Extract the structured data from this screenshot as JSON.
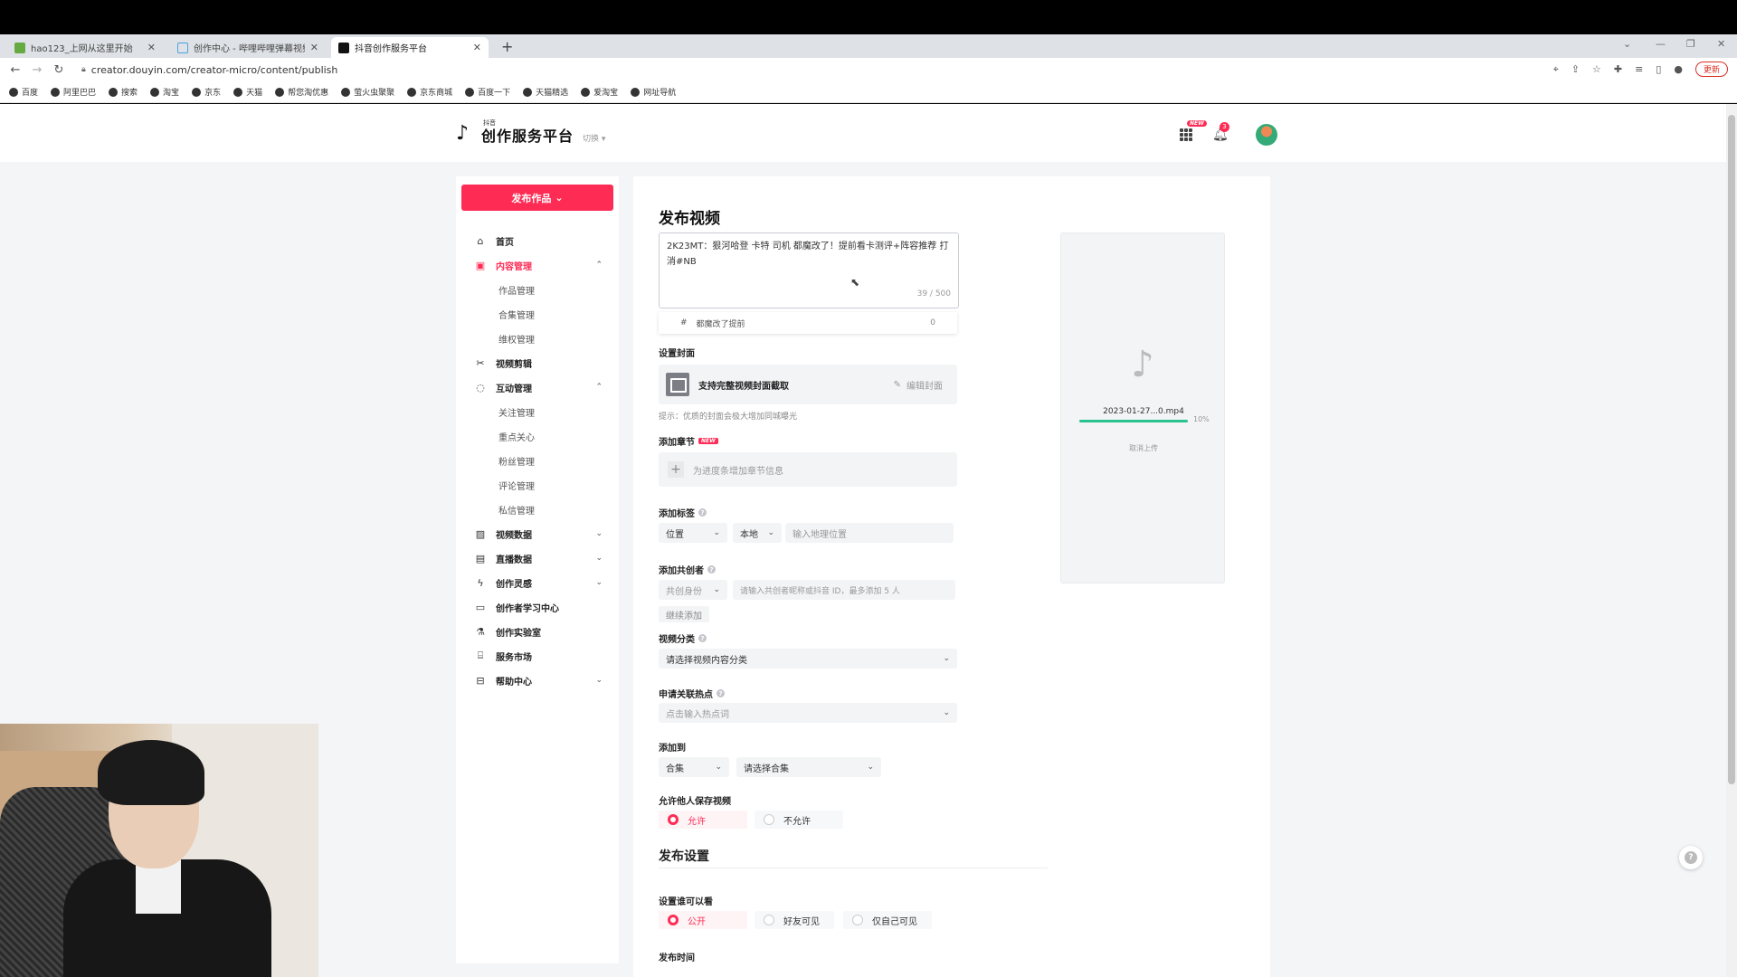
{
  "browser": {
    "tabs": [
      {
        "title": "hao123_上网从这里开始",
        "active": false
      },
      {
        "title": "创作中心 - 哔哩哔哩弹幕视频网",
        "active": false
      },
      {
        "title": "抖音创作服务平台",
        "active": true
      }
    ],
    "url": "creator.douyin.com/creator-micro/content/publish",
    "update_label": "更新",
    "bookmarks": [
      "百度",
      "阿里巴巴",
      "搜索",
      "淘宝",
      "京东",
      "天猫",
      "帮您淘优惠",
      "萤火虫聚聚",
      "京东商城",
      "百度一下",
      "天猫精选",
      "爱淘宝",
      "网址导航"
    ]
  },
  "header": {
    "logo_small": "抖音",
    "logo_text": "创作服务平台",
    "switch_label": "切换",
    "new_badge": "NEW",
    "notification_count": "3"
  },
  "sidebar": {
    "publish_label": "发布作品",
    "items": [
      {
        "label": "首页"
      },
      {
        "label": "内容管理",
        "sub": [
          "作品管理",
          "合集管理",
          "维权管理"
        ]
      },
      {
        "label": "视频剪辑"
      },
      {
        "label": "互动管理",
        "sub": [
          "关注管理",
          "重点关心",
          "粉丝管理",
          "评论管理",
          "私信管理"
        ]
      },
      {
        "label": "视频数据"
      },
      {
        "label": "直播数据"
      },
      {
        "label": "创作灵感"
      },
      {
        "label": "创作者学习中心"
      },
      {
        "label": "创作实验室"
      },
      {
        "label": "服务市场"
      },
      {
        "label": "帮助中心"
      }
    ]
  },
  "form": {
    "title": "发布视频",
    "description": "2K23MT：狠河哈登 卡特 司机 都魔改了！提前看卡测评+阵容推荐 打消#NB",
    "desc_count": "39 / 500",
    "topic": {
      "hash": "#",
      "text": "都魔改了提前",
      "count": "0"
    },
    "cover": {
      "label": "设置封面",
      "text": "支持完整视频封面截取",
      "edit": "编辑封面",
      "hint": "提示：优质的封面会极大增加同城曝光"
    },
    "chapter": {
      "label": "添加章节",
      "new": "NEW",
      "placeholder": "为进度条增加章节信息"
    },
    "tags": {
      "label": "添加标签",
      "type": "位置",
      "scope": "本地",
      "placeholder": "输入地理位置"
    },
    "cocreator": {
      "label": "添加共创者",
      "role": "共创身份",
      "placeholder": "请输入共创者昵称或抖音 ID，最多添加 5 人",
      "add_more": "继续添加"
    },
    "category": {
      "label": "视频分类",
      "placeholder": "请选择视频内容分类"
    },
    "hotspot": {
      "label": "申请关联热点",
      "placeholder": "点击输入热点词"
    },
    "add_to": {
      "label": "添加到",
      "type": "合集",
      "placeholder": "请选择合集"
    },
    "allow_save": {
      "label": "允许他人保存视频",
      "options": [
        "允许",
        "不允许"
      ],
      "selected": 0
    },
    "publish_settings": {
      "title": "发布设置"
    },
    "visibility": {
      "label": "设置谁可以看",
      "options": [
        "公开",
        "好友可见",
        "仅自己可见"
      ],
      "selected": 0
    },
    "publish_time": {
      "label": "发布时间"
    }
  },
  "upload": {
    "filename": "2023-01-27...0.mp4",
    "progress": 10,
    "progress_label": "10%",
    "cancel": "取消上传"
  },
  "colors": {
    "accent": "#fe2c55",
    "progress": "#28c38d"
  }
}
